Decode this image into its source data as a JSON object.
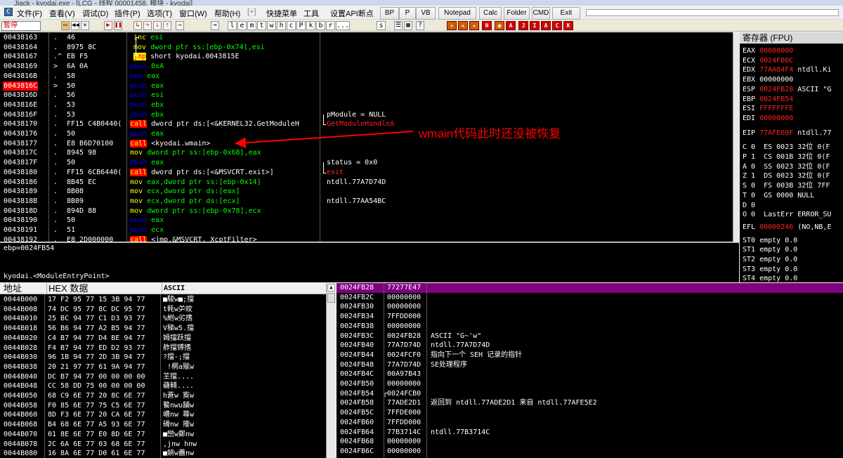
{
  "window": {
    "title": "Jiack - kyodai.exe - [LCG - 线程 00001458, 模块 - kyodai]"
  },
  "menu": {
    "items": [
      "文件(F)",
      "查看(V)",
      "调试(D)",
      "插件(P)",
      "选项(T)",
      "窗口(W)",
      "帮助(H)",
      "[+]",
      "快捷菜单",
      "工具",
      "设置API断点"
    ],
    "buttons": [
      "BP",
      "P",
      "VB",
      "Notepad",
      "Calc",
      "Folder",
      "CMD",
      "Exit"
    ]
  },
  "toolbar": {
    "status": "暂停",
    "letters": [
      "l",
      "e",
      "m",
      "t",
      "w",
      "h",
      "c",
      "P",
      "k",
      "b",
      "r",
      "...",
      "s"
    ]
  },
  "cpu": {
    "rows": [
      {
        "addr": "00438163",
        "mark": ".",
        "hex": "46",
        "op": "inc",
        "opn": "esi",
        "cmt": ""
      },
      {
        "addr": "00438164",
        "mark": ".",
        "hex": "8975 8C",
        "op": "mov",
        "opn": "dword ptr ss:[ebp-0x74],esi",
        "cmt": ""
      },
      {
        "addr": "00438167",
        "mark": ".^",
        "hex": "EB F5",
        "op": "jmp",
        "opn": "short kyodai.0043815E",
        "cmt": ""
      },
      {
        "addr": "00438169",
        "mark": ">",
        "hex": "6A 0A",
        "op": "push",
        "opn": "0xA",
        "cmt": ""
      },
      {
        "addr": "0043816B",
        "mark": ".",
        "hex": "58",
        "op": "pop",
        "opn": "eax",
        "cmt": ""
      },
      {
        "addr": "0043816C",
        "mark": ">",
        "hex": "50",
        "op": "push",
        "opn": "eax",
        "cmt": ""
      },
      {
        "addr": "0043816D",
        "mark": ".",
        "hex": "56",
        "op": "push",
        "opn": "esi",
        "cmt": ""
      },
      {
        "addr": "0043816E",
        "mark": ".",
        "hex": "53",
        "op": "push",
        "opn": "ebx",
        "cmt": ""
      },
      {
        "addr": "0043816F",
        "mark": ".",
        "hex": "53",
        "op": "push",
        "opn": "ebx",
        "cmt": "pModule = NULL"
      },
      {
        "addr": "00438170",
        "mark": ".",
        "hex": "FF15 C4B0440(",
        "op": "call",
        "opn": "dword ptr ds:[<&KERNEL32.GetModuleH",
        "cmt": "GetModuleHandleA"
      },
      {
        "addr": "00438176",
        "mark": ".",
        "hex": "50",
        "op": "push",
        "opn": "eax",
        "cmt": ""
      },
      {
        "addr": "00438177",
        "mark": ".",
        "hex": "E8 B6D70100",
        "op": "call",
        "opn": "<kyodai.wmain>",
        "cmt": ""
      },
      {
        "addr": "0043817C",
        "mark": ".",
        "hex": "8945 98",
        "op": "mov",
        "opn": "dword ptr ss:[ebp-0x68],eax",
        "cmt": ""
      },
      {
        "addr": "0043817F",
        "mark": ".",
        "hex": "50",
        "op": "push",
        "opn": "eax",
        "cmt": "status = 0x0"
      },
      {
        "addr": "00438180",
        "mark": ".",
        "hex": "FF15 6CB6440(",
        "op": "call",
        "opn": "dword ptr ds:[<&MSVCRT.exit>]",
        "cmt": "exit"
      },
      {
        "addr": "00438186",
        "mark": ".",
        "hex": "8B45 EC",
        "op": "mov",
        "opn": "eax,dword ptr ss:[ebp-0x14]",
        "cmt": "ntdll.77A7D74D"
      },
      {
        "addr": "00438189",
        "mark": ".",
        "hex": "8B08",
        "op": "mov",
        "opn": "ecx,dword ptr ds:[eax]",
        "cmt": ""
      },
      {
        "addr": "0043818B",
        "mark": ".",
        "hex": "8B09",
        "op": "mov",
        "opn": "ecx,dword ptr ds:[ecx]",
        "cmt": "ntdll.77AA54BC"
      },
      {
        "addr": "0043818D",
        "mark": ".",
        "hex": "894D 88",
        "op": "mov",
        "opn": "dword ptr ss:[ebp-0x78],ecx",
        "cmt": ""
      },
      {
        "addr": "00438190",
        "mark": ".",
        "hex": "50",
        "op": "push",
        "opn": "eax",
        "cmt": ""
      },
      {
        "addr": "00438191",
        "mark": ".",
        "hex": "51",
        "op": "push",
        "opn": "ecx",
        "cmt": ""
      },
      {
        "addr": "00438192",
        "mark": ".",
        "hex": "E8 2D000000",
        "op": "call",
        "opn": "<jmp.&MSVCRT._XcptFilter>",
        "cmt": ""
      }
    ],
    "current_addr": "0043816C"
  },
  "annotation": "wmain代码此时还没被恢复",
  "info": {
    "line1": "ebp=0024FB54",
    "line2": "kyodai.<ModuleEntryPoint>"
  },
  "registers": {
    "title": "寄存器 (FPU)",
    "gp": [
      {
        "n": "EAX",
        "v": "00000000",
        "c": ""
      },
      {
        "n": "ECX",
        "v": "0024FB0C",
        "c": ""
      },
      {
        "n": "EDX",
        "v": "77AA64F4",
        "c": "ntdll.Ki"
      },
      {
        "n": "EBX",
        "v": "00000000",
        "c": ""
      },
      {
        "n": "ESP",
        "v": "0024FB28",
        "c": "ASCII \"G"
      },
      {
        "n": "EBP",
        "v": "0024FB54",
        "c": ""
      },
      {
        "n": "ESI",
        "v": "FFFFFFFE",
        "c": ""
      },
      {
        "n": "EDI",
        "v": "00000000",
        "c": ""
      }
    ],
    "eip": {
      "n": "EIP",
      "v": "77AFE60F",
      "c": "ntdll.77"
    },
    "flags": [
      "C 0  ES 0023 32位 0(F",
      "P 1  CS 001B 32位 0(F",
      "A 0  SS 0023 32位 0(F",
      "Z 1  DS 0023 32位 0(F",
      "S 0  FS 003B 32位 7FF",
      "T 0  GS 0000 NULL",
      "D 0",
      "O 0  LastErr ERROR_SU"
    ],
    "efl": {
      "n": "EFL",
      "v": "00000246",
      "c": "(NO,NB,E"
    },
    "fpu": [
      "ST0 empty 0.0",
      "ST1 empty 0.0",
      "ST2 empty 0.0",
      "ST3 empty 0.0",
      "ST4 empty 0.0"
    ]
  },
  "dump": {
    "headers": {
      "addr": "地址",
      "hex": "HEX 数据",
      "ascii": "ASCII"
    },
    "rows": [
      {
        "a": "0044B000",
        "h": "17 F2 95 77 15 3B 94 77",
        "s": "■駿w■;擋"
      },
      {
        "a": "0044B008",
        "h": "74 DC 95 77 8C DC 95 77",
        "s": "t軞w屰旼"
      },
      {
        "a": "0044B010",
        "h": "25 BC 94 77 C1 D3 93 77",
        "s": "%紨w劣搘"
      },
      {
        "a": "0044B018",
        "h": "56 B6 94 77 A2 B5 94 77",
        "s": "V稊w5.擋"
      },
      {
        "a": "0044B020",
        "h": "C4 B7 94 77 D4 BE 94 77",
        "s": "姆擋跃擋"
      },
      {
        "a": "0044B028",
        "h": "F4 B7 94 77 ED D2 93 77",
        "s": "舴擋镈搘"
      },
      {
        "a": "0044B030",
        "h": "96 1B 94 77 2D 3B 94 77",
        "s": "?擋-;擋"
      },
      {
        "a": "0044B038",
        "h": "20 21 97 77 61 9A 94 77",
        "s": " !棢a殧w"
      },
      {
        "a": "0044B040",
        "h": "DC B7 94 77 00 00 00 00",
        "s": "芏擋...."
      },
      {
        "a": "0044B048",
        "h": "CC 58 DD 75 00 00 00 00",
        "s": "蘕輚...."
      },
      {
        "a": "0044B050",
        "h": "68 C9 6E 77 20 8C 6E 77",
        "s": "h蒼w 寏w"
      },
      {
        "a": "0044B058",
        "h": "F0 85 6E 77 75 C5 6E 77",
        "s": "饏nwu舗w"
      },
      {
        "a": "0044B060",
        "h": "8D F3 6E 77 20 CA 6E 77",
        "s": "嶆nw 蕁w"
      },
      {
        "a": "0044B068",
        "h": "B4 68 6E 77 A5 93 6E 77",
        "s": "磆nw 搉w"
      },
      {
        "a": "0044B070",
        "h": "01 8E 6E 77 E0 8D 6E 77",
        "s": "■巒w鄭nw"
      },
      {
        "a": "0044B078",
        "h": "2C 6A 6E 77 03 68 6E 77",
        "s": ",jnw hnw"
      },
      {
        "a": "0044B080",
        "h": "16 8A 6E 77 D0 61 6E 77",
        "s": "■妌w衋nw"
      }
    ]
  },
  "stack": {
    "rows": [
      {
        "a": "0024FB28",
        "v": "77277E47",
        "c": "",
        "top": true
      },
      {
        "a": "0024FB2C",
        "v": "00000000",
        "c": ""
      },
      {
        "a": "0024FB30",
        "v": "00000000",
        "c": ""
      },
      {
        "a": "0024FB34",
        "v": "7FFDD000",
        "c": ""
      },
      {
        "a": "0024FB38",
        "v": "00000000",
        "c": ""
      },
      {
        "a": "0024FB3C",
        "v": "0024FB28",
        "c": "ASCII \"G~'w\""
      },
      {
        "a": "0024FB40",
        "v": "77A7D74D",
        "c": "ntdll.77A7D74D"
      },
      {
        "a": "0024FB44",
        "v": "0024FCF0",
        "c": "指向下一个 SEH 记录的指针"
      },
      {
        "a": "0024FB48",
        "v": "77A7D74D",
        "c": "SE处理程序"
      },
      {
        "a": "0024FB4C",
        "v": "00A97B43",
        "c": ""
      },
      {
        "a": "0024FB50",
        "v": "00000000",
        "c": ""
      },
      {
        "a": "0024FB54",
        "v": "┌0024FCB0",
        "c": ""
      },
      {
        "a": "0024FB58",
        "v": "77ADE2D1",
        "c": "返回到 ntdll.77ADE2D1 来自 ntdll.77AFE5E2"
      },
      {
        "a": "0024FB5C",
        "v": "7FFDE000",
        "c": ""
      },
      {
        "a": "0024FB60",
        "v": "7FFDD000",
        "c": ""
      },
      {
        "a": "0024FB64",
        "v": "77B3714C",
        "c": "ntdll.77B3714C"
      },
      {
        "a": "0024FB68",
        "v": "00000000",
        "c": ""
      },
      {
        "a": "0024FB6C",
        "v": "00000000",
        "c": ""
      }
    ]
  },
  "colors": {
    "red": "#ff0000",
    "yellow": "#ffff00",
    "blue": "#0000ff",
    "purple": "#800080"
  }
}
